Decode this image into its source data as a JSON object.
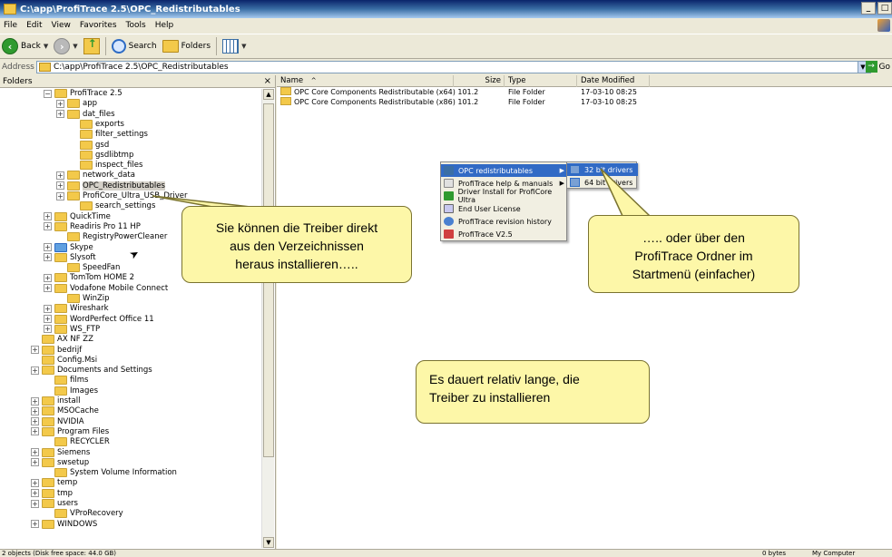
{
  "window": {
    "title": "C:\\app\\ProfiTrace 2.5\\OPC_Redistributables",
    "controls": [
      "_",
      "□"
    ]
  },
  "menubar": {
    "items": [
      "File",
      "Edit",
      "View",
      "Favorites",
      "Tools",
      "Help"
    ]
  },
  "toolbar": {
    "back_label": "Back",
    "search_label": "Search",
    "folders_label": "Folders"
  },
  "address": {
    "label": "Address",
    "value": "C:\\app\\ProfiTrace 2.5\\OPC_Redistributables",
    "go_label": "Go"
  },
  "folders_pane": {
    "title": "Folders",
    "close": "×",
    "items": [
      {
        "label": "ProfiTrace 2.5",
        "expander": "−"
      },
      {
        "label": "app",
        "expander": "+"
      },
      {
        "label": "dat_files",
        "expander": "+"
      },
      {
        "label": "exports",
        "expander": ""
      },
      {
        "label": "filter_settings",
        "expander": ""
      },
      {
        "label": "gsd",
        "expander": ""
      },
      {
        "label": "gsdlibtmp",
        "expander": ""
      },
      {
        "label": "inspect_files",
        "expander": ""
      },
      {
        "label": "network_data",
        "expander": "+"
      },
      {
        "label": "OPC_Redistributables",
        "expander": "+"
      },
      {
        "label": "ProfiCore_Ultra_USB_Driver",
        "expander": "+"
      },
      {
        "label": "search_settings",
        "expander": ""
      },
      {
        "label": "QuickTime",
        "expander": "+"
      },
      {
        "label": "Readiris Pro 11 HP",
        "expander": "+"
      },
      {
        "label": "RegistryPowerCleaner",
        "expander": ""
      },
      {
        "label": "Skype",
        "expander": "+"
      },
      {
        "label": "Slysoft",
        "expander": "+"
      },
      {
        "label": "SpeedFan",
        "expander": ""
      },
      {
        "label": "TomTom HOME 2",
        "expander": "+"
      },
      {
        "label": "Vodafone Mobile Connect",
        "expander": "+"
      },
      {
        "label": "WinZip",
        "expander": ""
      },
      {
        "label": "Wireshark",
        "expander": "+"
      },
      {
        "label": "WordPerfect Office 11",
        "expander": "+"
      },
      {
        "label": "WS_FTP",
        "expander": "+"
      },
      {
        "label": "AX NF ZZ",
        "expander": ""
      },
      {
        "label": "bedrijf",
        "expander": "+"
      },
      {
        "label": "Config.Msi",
        "expander": ""
      },
      {
        "label": "Documents and Settings",
        "expander": "+"
      },
      {
        "label": "films",
        "expander": ""
      },
      {
        "label": "Images",
        "expander": ""
      },
      {
        "label": "install",
        "expander": "+"
      },
      {
        "label": "MSOCache",
        "expander": "+"
      },
      {
        "label": "NVIDIA",
        "expander": "+"
      },
      {
        "label": "Program Files",
        "expander": "+"
      },
      {
        "label": "RECYCLER",
        "expander": ""
      },
      {
        "label": "Siemens",
        "expander": "+"
      },
      {
        "label": "swsetup",
        "expander": "+"
      },
      {
        "label": "System Volume Information",
        "expander": ""
      },
      {
        "label": "temp",
        "expander": "+"
      },
      {
        "label": "tmp",
        "expander": "+"
      },
      {
        "label": "users",
        "expander": "+"
      },
      {
        "label": "VProRecovery",
        "expander": ""
      },
      {
        "label": "WINDOWS",
        "expander": "+"
      }
    ]
  },
  "file_list": {
    "headers": {
      "name": "Name",
      "sort": "^",
      "size": "Size",
      "type": "Type",
      "date": "Date Modified"
    },
    "rows": [
      {
        "name": "OPC Core Components Redistributable (x64) 101.2",
        "size": "",
        "type": "File Folder",
        "date": "17-03-10 08:25"
      },
      {
        "name": "OPC Core Components Redistributable (x86) 101.2",
        "size": "",
        "type": "File Folder",
        "date": "17-03-10 08:25"
      }
    ]
  },
  "start_menu": {
    "items": [
      {
        "label": "OPC redistributables",
        "icon_color": "#3a6ea5",
        "submenu": "▶"
      },
      {
        "label": "ProfiTrace help & manuals",
        "icon_color": "#e0e0e0",
        "submenu": "▶"
      },
      {
        "label": "Driver Install for ProfiCore Ultra",
        "icon_color": "#2f9a2f",
        "submenu": ""
      },
      {
        "label": "End User License",
        "icon_color": "#c8c8f0",
        "submenu": ""
      },
      {
        "label": "ProfiTrace revision history",
        "icon_color": "#4a80d0",
        "submenu": ""
      },
      {
        "label": "ProfiTrace V2.5",
        "icon_color": "#d04040",
        "submenu": ""
      }
    ],
    "submenu_items": [
      {
        "label": "32 bit drivers"
      },
      {
        "label": "64 bit drivers"
      }
    ]
  },
  "callouts": {
    "left": [
      "Sie können die Treiber direkt",
      "aus den Verzeichnissen",
      "heraus installieren….."
    ],
    "right": [
      "….. oder über den",
      "ProfiTrace Ordner im",
      "Startmenü (einfacher)"
    ],
    "bottom": [
      "Es dauert relativ lange, die",
      "Treiber zu installieren"
    ]
  },
  "statusbar": {
    "left": "2 objects (Disk free space: 44.0 GB)",
    "size": "0 bytes",
    "location": "My Computer"
  }
}
